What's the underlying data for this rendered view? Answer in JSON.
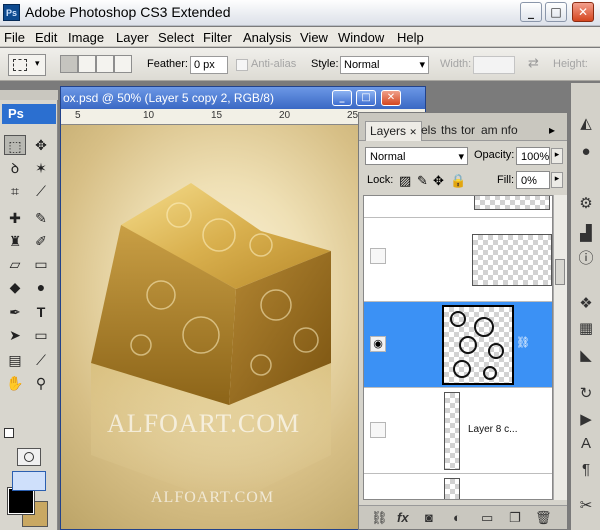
{
  "app": {
    "logo": "Ps",
    "title": "Adobe Photoshop CS3 Extended"
  },
  "window_controls": {
    "minimize": "_",
    "maximize": "□",
    "close": "✕"
  },
  "menu": [
    "File",
    "Edit",
    "Image",
    "Layer",
    "Select",
    "Filter",
    "Analysis",
    "View",
    "Window",
    "Help"
  ],
  "options": {
    "feather_label": "Feather:",
    "feather_value": "0 px",
    "antialias_label": "Anti-alias",
    "style_label": "Style:",
    "style_value": "Normal",
    "width_label": "Width:",
    "width_value": "",
    "height_label": "Height:"
  },
  "toolbox": {
    "logo": "Ps",
    "tools": [
      "marquee-icon",
      "move-icon",
      "lasso-icon",
      "magic-wand-icon",
      "crop-icon",
      "slice-icon",
      "healing-icon",
      "brush-icon",
      "stamp-icon",
      "history-brush-icon",
      "eraser-icon",
      "gradient-icon",
      "blur-icon",
      "dodge-icon",
      "pen-icon",
      "type-icon",
      "path-select-icon",
      "shape-icon",
      "notes-icon",
      "eyedropper-icon",
      "hand-icon",
      "zoom-icon"
    ],
    "foreground_color": "#000000",
    "background_color": "#c9a862"
  },
  "document": {
    "title": "ox.psd @ 50% (Layer 5 copy 2, RGB/8)",
    "ruler_marks": [
      "5",
      "10",
      "15",
      "20",
      "25"
    ],
    "watermark_main": "ALFOART.COM",
    "watermark_bottom": "ALFOART.COM"
  },
  "layers_panel": {
    "tabs": [
      "Layers",
      "els",
      "ths",
      "tor",
      "am",
      "nfo"
    ],
    "blend_mode": "Normal",
    "opacity_label": "Opacity:",
    "opacity_value": "100%",
    "lock_label": "Lock:",
    "fill_label": "Fill:",
    "fill_value": "0%",
    "layers": [
      {
        "name": "",
        "visible": false,
        "selected": false
      },
      {
        "name": "",
        "visible": false,
        "selected": false
      },
      {
        "name": "",
        "visible": true,
        "selected": true
      },
      {
        "name": "Layer 8 c...",
        "visible": false,
        "selected": false
      },
      {
        "name": "",
        "visible": false,
        "selected": false
      }
    ],
    "bottom_icons": [
      "link-icon",
      "fx-icon",
      "mask-icon",
      "adjustment-icon",
      "group-icon",
      "new-layer-icon",
      "trash-icon"
    ],
    "fx_label": "fx"
  },
  "colors": {
    "selected_layer": "#3b91f5",
    "doc_titlebar": "#3a68c4"
  }
}
